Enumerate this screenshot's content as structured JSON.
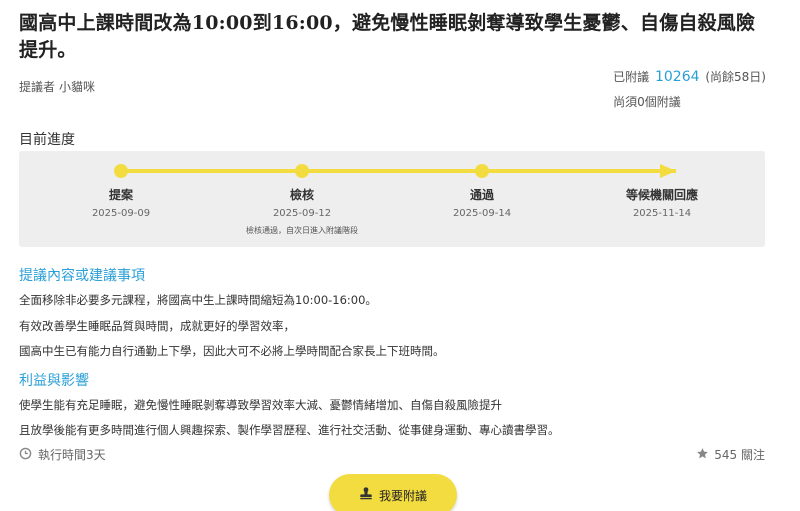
{
  "title": "國高中上課時間改為10:00到16:00，避免慢性睡眠剝奪導致學生憂鬱、自傷自殺風險提升。",
  "proposer": {
    "label": "提議者",
    "name": "小貓咪"
  },
  "stats": {
    "prefix": "已附議",
    "count": "10264",
    "remaining": "(尚餘58日)",
    "needed": "尚須0個附議"
  },
  "progress": {
    "title": "目前進度",
    "stages": [
      {
        "label": "提案",
        "date": "2025-09-09",
        "note": ""
      },
      {
        "label": "檢核",
        "date": "2025-09-12",
        "note": "檢核通過，自次日進入附議階段"
      },
      {
        "label": "通過",
        "date": "2025-09-14",
        "note": ""
      },
      {
        "label": "等候機關回應",
        "date": "2025-11-14",
        "note": ""
      }
    ],
    "color": "#f3dc40"
  },
  "content": {
    "heading": "提議內容或建議事項",
    "lines": [
      "全面移除非必要多元課程，將國高中生上課時間縮短為10:00-16:00。",
      "有效改善學生睡眠品質與時間，成就更好的學習效率，",
      "國高中生已有能力自行通勤上下學，因此大可不必將上學時間配合家長上下班時間。"
    ]
  },
  "benefits": {
    "heading": "利益與影響",
    "lines": [
      "使學生能有充足睡眠，避免慢性睡眠剝奪導致學習效率大減、憂鬱情緒增加、自傷自殺風險提升",
      "且放學後能有更多時間進行個人興趣探索、製作學習歷程、進行社交活動、從事健身運動、專心讀書學習。"
    ]
  },
  "footer": {
    "exec_time": "執行時間3天",
    "exec_icon": "clock-icon",
    "follow": "545 關注",
    "follow_icon": "star-icon"
  },
  "sign_button": {
    "label": "我要附議",
    "icon": "stamp-icon"
  },
  "accent_color": "#2a9fd6"
}
